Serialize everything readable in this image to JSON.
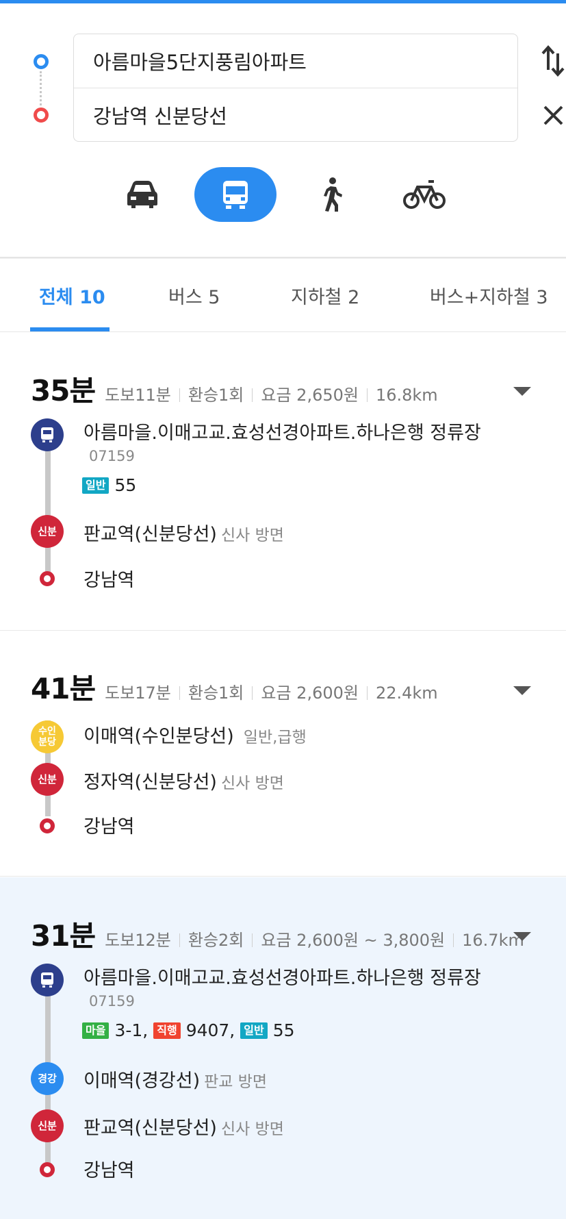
{
  "search": {
    "origin": "아름마을5단지풍림아파트",
    "destination": "강남역 신분당선"
  },
  "tabs": [
    {
      "label": "전체 10"
    },
    {
      "label": "버스 5"
    },
    {
      "label": "지하철 2"
    },
    {
      "label": "버스+지하철 3"
    }
  ],
  "routes": [
    {
      "time": "35분",
      "walk": "도보11분",
      "transfer": "환승1회",
      "fare": "요금 2,650원",
      "distance": "16.8km",
      "steps": [
        {
          "kind": "bus",
          "badge": "",
          "name": "아름마을.이매고교.효성선경아파트.하나은행 정류장",
          "stop_id": "07159",
          "lines": [
            {
              "tag": "일반",
              "number": "55"
            }
          ]
        },
        {
          "kind": "subway",
          "badge": "신분",
          "name": "판교역(신분당선)",
          "direction": "신사 방면"
        },
        {
          "kind": "end",
          "name": "강남역"
        }
      ]
    },
    {
      "time": "41분",
      "walk": "도보17분",
      "transfer": "환승1회",
      "fare": "요금 2,600원",
      "distance": "22.4km",
      "steps": [
        {
          "kind": "subway",
          "badge": "수인\n분당",
          "name": "이매역(수인분당선)",
          "direction": "일반,급행"
        },
        {
          "kind": "subway",
          "badge": "신분",
          "name": "정자역(신분당선)",
          "direction": "신사 방면"
        },
        {
          "kind": "end",
          "name": "강남역"
        }
      ]
    },
    {
      "time": "31분",
      "walk": "도보12분",
      "transfer": "환승2회",
      "fare": "요금 2,600원 ~ 3,800원",
      "distance": "16.7km",
      "steps": [
        {
          "kind": "bus",
          "badge": "",
          "name": "아름마을.이매고교.효성선경아파트.하나은행 정류장",
          "stop_id": "07159",
          "lines": [
            {
              "tag": "마을",
              "number": "3-1,"
            },
            {
              "tag": "직행",
              "number": "9407,"
            },
            {
              "tag": "일반",
              "number": "55"
            }
          ]
        },
        {
          "kind": "subway",
          "badge": "경강",
          "name": "이매역(경강선)",
          "direction": "판교 방면"
        },
        {
          "kind": "subway",
          "badge": "신분",
          "name": "판교역(신분당선)",
          "direction": "신사 방면"
        },
        {
          "kind": "end",
          "name": "강남역"
        }
      ]
    }
  ],
  "colors": {
    "accent": "#2b8cf0",
    "sinbundang": "#d0263a",
    "suin_bundang": "#f6c935",
    "gyeonggang": "#2b8cf0",
    "bus_stop": "#2d3f8c",
    "tag_ilban": "#12a7c4",
    "tag_maeul": "#33b044",
    "tag_jikhaeng": "#f0432f",
    "highlight_bg": "#eef5fd"
  },
  "icons": {
    "swap": "swap-icon",
    "clear": "close-icon",
    "car": "car-icon",
    "bus": "bus-icon",
    "walk": "walk-icon",
    "bike": "bicycle-icon",
    "expand": "caret-down-icon"
  }
}
